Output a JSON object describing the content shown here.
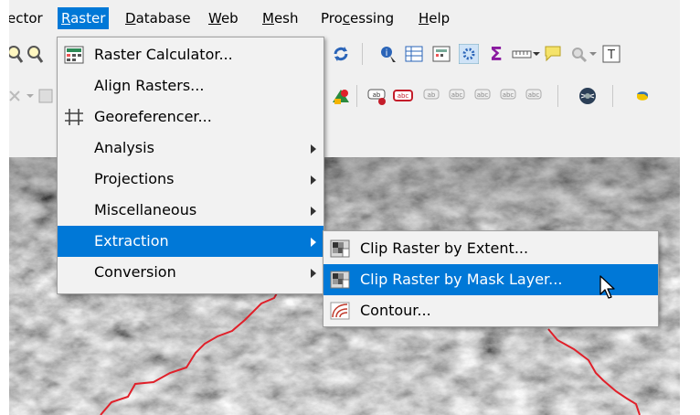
{
  "menubar": {
    "items": [
      {
        "label": "ector",
        "active": false
      },
      {
        "label": "Raster",
        "active": true
      },
      {
        "label": "Database",
        "active": false
      },
      {
        "label": "Web",
        "active": false
      },
      {
        "label": "Mesh",
        "active": false
      },
      {
        "label": "Processing",
        "active": false
      },
      {
        "label": "Help",
        "active": false
      }
    ]
  },
  "raster_menu": {
    "items": [
      {
        "label": "Raster Calculator...",
        "icon": "raster-calculator-icon"
      },
      {
        "label": "Align Rasters...",
        "icon": ""
      },
      {
        "label": "Georeferencer...",
        "icon": "georeferencer-icon"
      },
      {
        "label": "Analysis",
        "submenu": true
      },
      {
        "label": "Projections",
        "submenu": true
      },
      {
        "label": "Miscellaneous",
        "submenu": true
      },
      {
        "label": "Extraction",
        "submenu": true,
        "highlighted": true
      },
      {
        "label": "Conversion",
        "submenu": true
      }
    ]
  },
  "extraction_submenu": {
    "items": [
      {
        "label": "Clip Raster by Extent...",
        "icon": "clip-raster-extent-icon"
      },
      {
        "label": "Clip Raster by Mask Layer...",
        "icon": "clip-raster-mask-icon",
        "highlighted": true
      },
      {
        "label": "Contour...",
        "icon": "contour-icon"
      }
    ]
  },
  "colors": {
    "highlight": "#0078d7",
    "boundary_line": "#e0202a",
    "menu_background": "#f2f2f2"
  }
}
